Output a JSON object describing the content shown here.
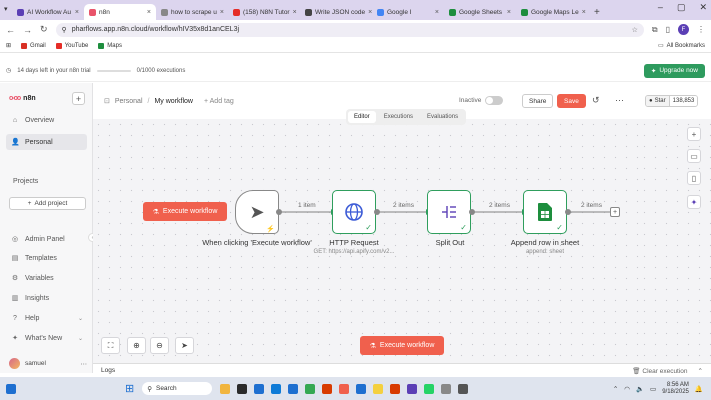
{
  "browser": {
    "tabs": [
      {
        "label": "AI Workflow Au",
        "color": "#5b3fb5"
      },
      {
        "label": "n8n",
        "color": "#e9546a",
        "active": true
      },
      {
        "label": "how to scrape u",
        "color": "#888888"
      },
      {
        "label": "(158) N8N Tutor",
        "color": "#e52d27"
      },
      {
        "label": "Write JSON code",
        "color": "#444444"
      },
      {
        "label": "Google I",
        "color": "#4285f4"
      },
      {
        "label": "Google Sheets",
        "color": "#1e8e3e"
      },
      {
        "label": "Google Maps Le",
        "color": "#1e8e3e"
      }
    ],
    "url": "pharflows.app.n8n.cloud/workflow/hIV35x8d1anCEL3j",
    "bookmarks": [
      {
        "label": "Gmail",
        "color": "#d93025"
      },
      {
        "label": "YouTube",
        "color": "#e52d27"
      },
      {
        "label": "Maps",
        "color": "#1e8e3e"
      }
    ],
    "all_bookmarks": "All Bookmarks",
    "profile_initial": "F"
  },
  "trial": {
    "text": "14 days left in your n8n trial",
    "executions": "0/1000 executions",
    "progress_fraction": 0.0,
    "upgrade_label": "Upgrade now"
  },
  "sidebar": {
    "brand": "n8n",
    "items": [
      {
        "label": "Overview",
        "icon": "home-icon",
        "glyph": "⌂"
      },
      {
        "label": "Personal",
        "icon": "user-icon",
        "glyph": "👤",
        "active": true
      }
    ],
    "projects_heading": "Projects",
    "add_project": "Add project",
    "bottom_items": [
      {
        "label": "Admin Panel",
        "glyph": "◎",
        "icon": "cloud-icon"
      },
      {
        "label": "Templates",
        "glyph": "▤",
        "icon": "templates-icon"
      },
      {
        "label": "Variables",
        "glyph": "⚙",
        "icon": "variables-icon"
      },
      {
        "label": "Insights",
        "glyph": "▥",
        "icon": "insights-icon"
      },
      {
        "label": "Help",
        "glyph": "?",
        "icon": "help-icon",
        "chevron": true
      },
      {
        "label": "What's New",
        "glyph": "✦",
        "icon": "bell-icon",
        "chevron": true
      }
    ],
    "user_name": "samuel"
  },
  "header": {
    "project": "Personal",
    "workflow_name": "My workflow",
    "add_tag": "+ Add tag",
    "status": "Inactive",
    "share": "Share",
    "save": "Save",
    "github_label": "Star",
    "github_count": "138,853"
  },
  "canvas_tabs": [
    "Editor",
    "Executions",
    "Evaluations"
  ],
  "execute_label": "Execute workflow",
  "nodes": [
    {
      "label": "When clicking 'Execute workflow'",
      "subtitle": "",
      "icon": "cursor-icon"
    },
    {
      "label": "HTTP Request",
      "subtitle": "GET: https://api.apify.com/v2...",
      "icon": "globe-icon"
    },
    {
      "label": "Split Out",
      "subtitle": "",
      "icon": "split-icon"
    },
    {
      "label": "Append row in sheet",
      "subtitle": "append: sheet",
      "icon": "google-sheets-icon"
    }
  ],
  "edges": [
    "1 item",
    "2 items",
    "2 items",
    "2 items"
  ],
  "logs": {
    "label": "Logs",
    "clear": "Clear execution"
  },
  "taskbar": {
    "search": "Search",
    "time": "8:56 AM",
    "date": "9/18/2025"
  }
}
